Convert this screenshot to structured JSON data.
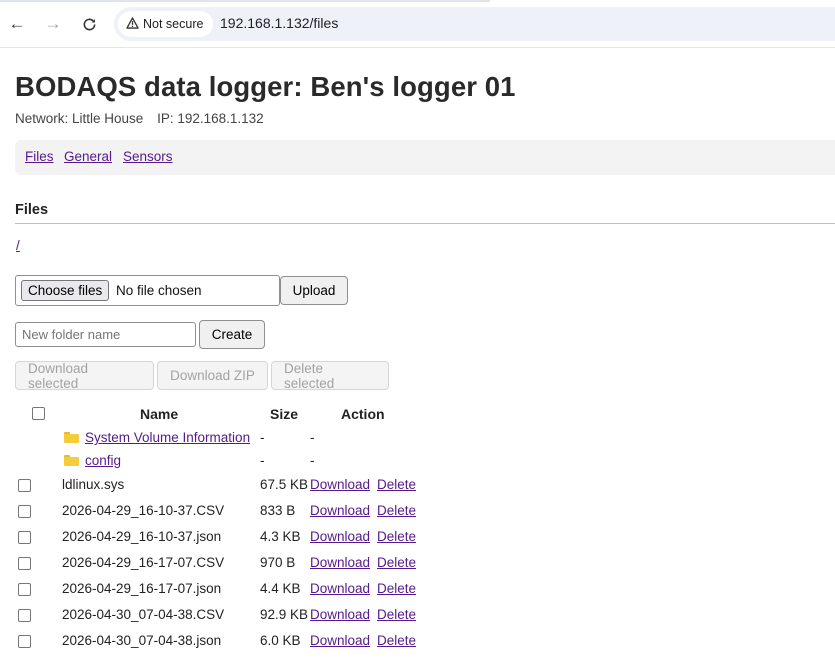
{
  "browser": {
    "security_label": "Not secure",
    "url": "192.168.1.132/files"
  },
  "header": {
    "title": "BODAQS data logger: Ben's logger 01",
    "network": "Network: Little House",
    "ip": "IP: 192.168.1.132"
  },
  "nav": {
    "files": "Files",
    "general": "General",
    "sensors": "Sensors"
  },
  "files": {
    "section_title": "Files",
    "breadcrumb": "/",
    "choose_label": "Choose files",
    "no_file_text": "No file chosen",
    "upload_label": "Upload",
    "folder_placeholder": "New folder name",
    "create_label": "Create",
    "download_selected": "Download selected",
    "download_zip": "Download ZIP",
    "delete_selected": "Delete selected",
    "columns": {
      "name": "Name",
      "size": "Size",
      "action": "Action"
    },
    "folders": [
      {
        "name": "System Volume Information",
        "size": "-",
        "action": "-"
      },
      {
        "name": "config",
        "size": "-",
        "action": "-"
      }
    ],
    "rows": [
      {
        "name": "ldlinux.sys",
        "size": "67.5 KB",
        "download": "Download",
        "delete": "Delete"
      },
      {
        "name": "2026-04-29_16-10-37.CSV",
        "size": "833 B",
        "download": "Download",
        "delete": "Delete"
      },
      {
        "name": "2026-04-29_16-10-37.json",
        "size": "4.3 KB",
        "download": "Download",
        "delete": "Delete"
      },
      {
        "name": "2026-04-29_16-17-07.CSV",
        "size": "970 B",
        "download": "Download",
        "delete": "Delete"
      },
      {
        "name": "2026-04-29_16-17-07.json",
        "size": "4.4 KB",
        "download": "Download",
        "delete": "Delete"
      },
      {
        "name": "2026-04-30_07-04-38.CSV",
        "size": "92.9 KB",
        "download": "Download",
        "delete": "Delete"
      },
      {
        "name": "2026-04-30_07-04-38.json",
        "size": "6.0 KB",
        "download": "Download",
        "delete": "Delete"
      }
    ]
  },
  "colors": {
    "link": "#551a8b",
    "folder": "#f5cc3c"
  }
}
